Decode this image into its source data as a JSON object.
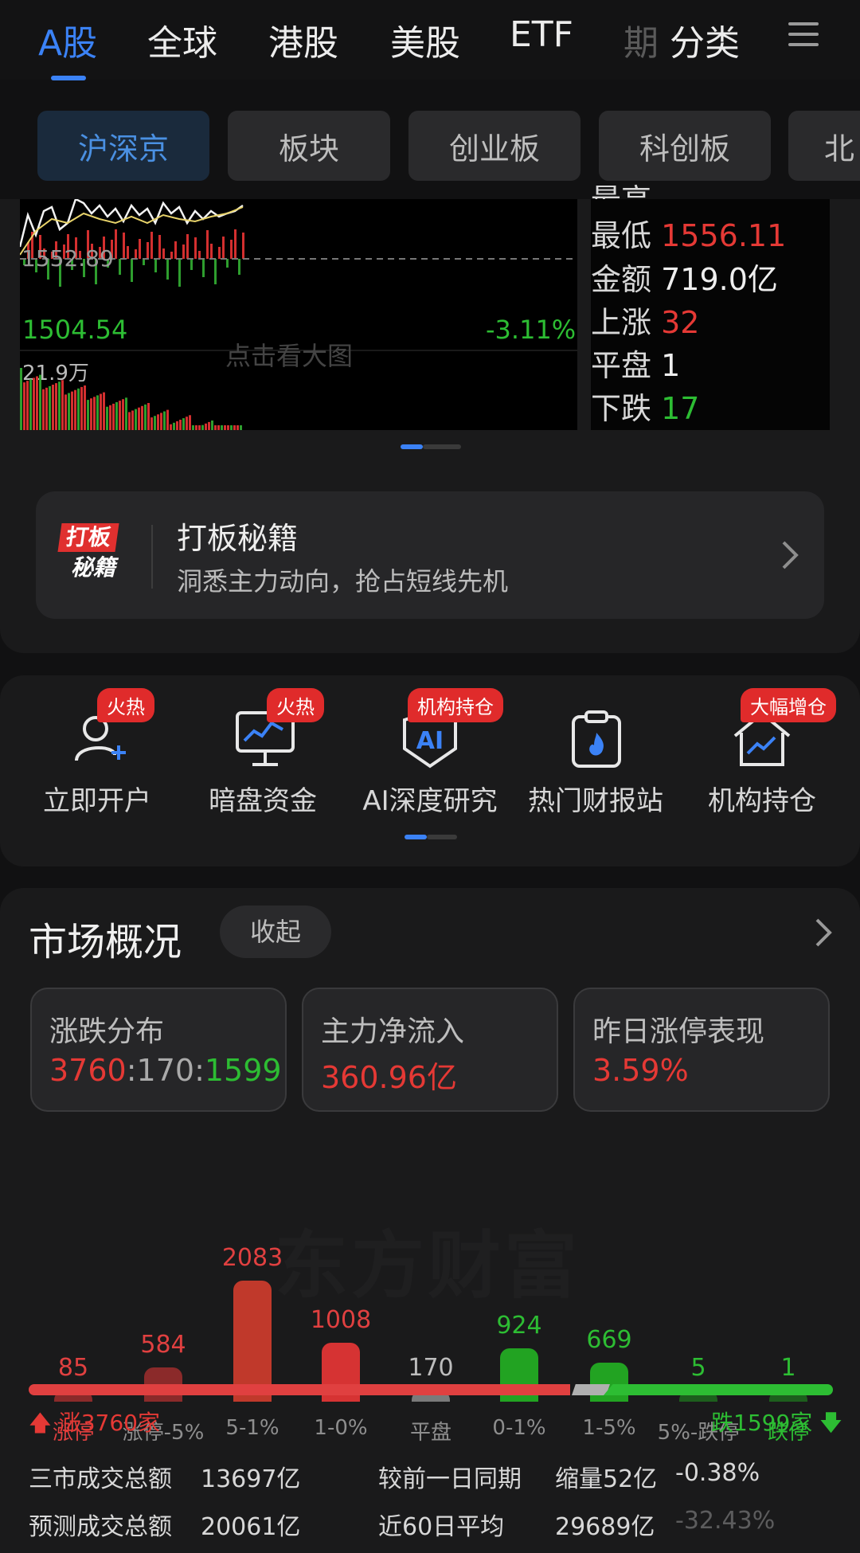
{
  "top_tabs": [
    "A股",
    "全球",
    "港股",
    "美股",
    "ETF",
    "期",
    "分类"
  ],
  "sub_tabs": [
    "沪深京",
    "板块",
    "创业板",
    "科创板",
    "北"
  ],
  "chart": {
    "ref_price": "1552.89",
    "low_price": "1504.54",
    "pct": "-3.11%",
    "volume": "21.9万",
    "hint": "点击看大图"
  },
  "stats": {
    "cut_label": "最高",
    "low_label": "最低",
    "low_value": "1556.11",
    "amount_label": "金额",
    "amount_value": "719.0亿",
    "up_label": "上涨",
    "up_value": "32",
    "flat_label": "平盘",
    "flat_value": "1",
    "down_label": "下跌",
    "down_value": "17"
  },
  "promo": {
    "icon_line1": "打板",
    "icon_line2": "秘籍",
    "title": "打板秘籍",
    "subtitle": "洞悉主力动向，抢占短线先机"
  },
  "features": [
    {
      "label": "立即开户",
      "badge": "火热",
      "icon": "user-add-icon"
    },
    {
      "label": "暗盘资金",
      "badge": "火热",
      "icon": "monitor-chart-icon"
    },
    {
      "label": "AI深度研究",
      "badge": "机构持仓",
      "icon": "ai-shield-icon"
    },
    {
      "label": "热门财报站",
      "badge": "",
      "icon": "fire-clipboard-icon"
    },
    {
      "label": "机构持仓",
      "badge": "大幅增仓",
      "icon": "house-trend-icon"
    }
  ],
  "market": {
    "title": "市场概况",
    "collapse": "收起",
    "cards": [
      {
        "title": "涨跌分布",
        "up": "3760",
        "sep1": ":",
        "flat": "170",
        "sep2": ":",
        "down": "1599"
      },
      {
        "title": "主力净流入",
        "value": "360.96亿"
      },
      {
        "title": "昨日涨停表现",
        "value": "3.59%"
      }
    ],
    "watermark": "东方财富",
    "up_summary": "涨3760家",
    "down_summary": "跌1599家",
    "rows": [
      {
        "label": "三市成交总额",
        "value": "13697亿",
        "label2": "较前一日同期",
        "value2": "缩量52亿",
        "value3": "-0.38%"
      },
      {
        "label": "预测成交总额",
        "value": "20061亿",
        "label2": "近60日平均",
        "value2": "29689亿",
        "value3": "-32.43%"
      }
    ]
  },
  "chart_data": {
    "type": "bar",
    "categories": [
      "涨停",
      "涨停-5%",
      "5-1%",
      "1-0%",
      "平盘",
      "0-1%",
      "1-5%",
      "5%-跌停",
      "跌停"
    ],
    "values": [
      85,
      584,
      2083,
      1008,
      170,
      924,
      669,
      5,
      1
    ],
    "colors": [
      "#8b2a2a",
      "#8b2a2a",
      "#c0392b",
      "#d63333",
      "#7a7a7a",
      "#22a322",
      "#22a322",
      "#1d5e1d",
      "#1d5e1d"
    ],
    "title": "",
    "xlabel": "",
    "ylabel": ""
  }
}
